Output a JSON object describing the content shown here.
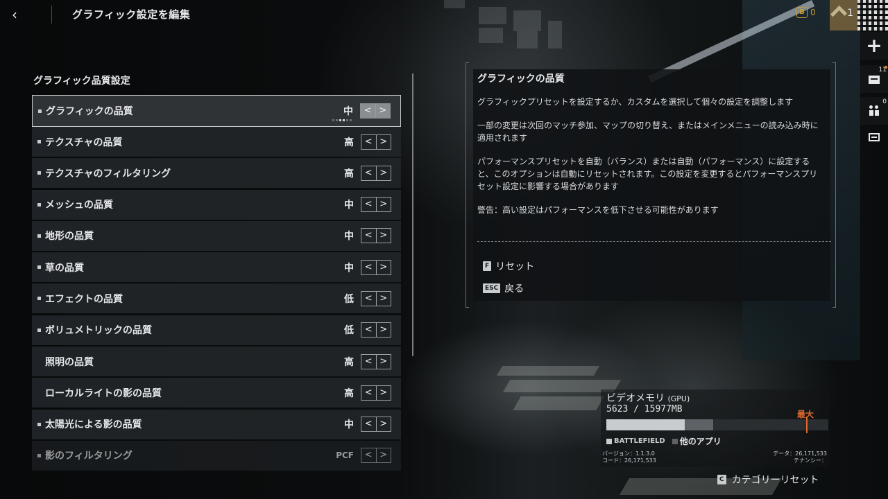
{
  "header": {
    "back_icon": "chevron-left-icon",
    "title": "グラフィック設定を編集",
    "currency_symbol": "B",
    "currency_value": "0",
    "rank_level": "1"
  },
  "rail": {
    "mail_count": "11",
    "party_count": "0"
  },
  "section": {
    "title": "グラフィック品質設定"
  },
  "settings": [
    {
      "label": "グラフィックの品質",
      "value": "中",
      "bullet": true
    },
    {
      "label": "テクスチャの品質",
      "value": "高",
      "bullet": true
    },
    {
      "label": "テクスチャのフィルタリング",
      "value": "高",
      "bullet": true
    },
    {
      "label": "メッシュの品質",
      "value": "中",
      "bullet": true
    },
    {
      "label": "地形の品質",
      "value": "中",
      "bullet": true
    },
    {
      "label": "草の品質",
      "value": "中",
      "bullet": true
    },
    {
      "label": "エフェクトの品質",
      "value": "低",
      "bullet": true
    },
    {
      "label": "ボリュメトリックの品質",
      "value": "低",
      "bullet": true
    },
    {
      "label": "照明の品質",
      "value": "高",
      "bullet": false
    },
    {
      "label": "ローカルライトの影の品質",
      "value": "高",
      "bullet": false
    },
    {
      "label": "太陽光による影の品質",
      "value": "中",
      "bullet": true
    },
    {
      "label": "影のフィルタリング",
      "value": "PCF",
      "bullet": true
    }
  ],
  "arrows": {
    "prev": "<",
    "next": ">"
  },
  "description": {
    "title": "グラフィックの品質",
    "p1": "グラフィックプリセットを設定するか、カスタムを選択して個々の設定を調整します",
    "p2": "一部の変更は次回のマッチ参加、マップの切り替え、またはメインメニューの読み込み時に適用されます",
    "p3": "パフォーマンスプリセットを自動（バランス）または自動（パフォーマンス）に設定すると、このオプションは自動にリセットされます。この設定を変更するとパフォーマンスプリセット設定に影響する場合があります",
    "p4": "警告：高い設定はパフォーマンスを低下させる可能性があります",
    "reset_key": "F",
    "reset_label": "リセット",
    "back_key": "ESC",
    "back_label": "戻る"
  },
  "vram": {
    "title": "ビデオメモリ",
    "title_suffix": "(GPU)",
    "usage": "5623 / 15977MB",
    "max_label": "最大",
    "battlefield_fraction": 0.352,
    "other_fraction": 0.13,
    "max_fraction": 0.9,
    "legend_battlefield": "BATTLEFIELD",
    "legend_other": "他のアプリ",
    "version_line": "バージョン：1.1.3.0",
    "code_line": "コード：26,171,533",
    "data_line": "データ：26,171,533",
    "tenancy_line": "テナンシー：",
    "battlefield_color": "#c9ccce",
    "other_color": "#5e6266",
    "max_color": "#e06a2e"
  },
  "footer": {
    "category_reset_key": "C",
    "category_reset_label": "カテゴリーリセット"
  }
}
